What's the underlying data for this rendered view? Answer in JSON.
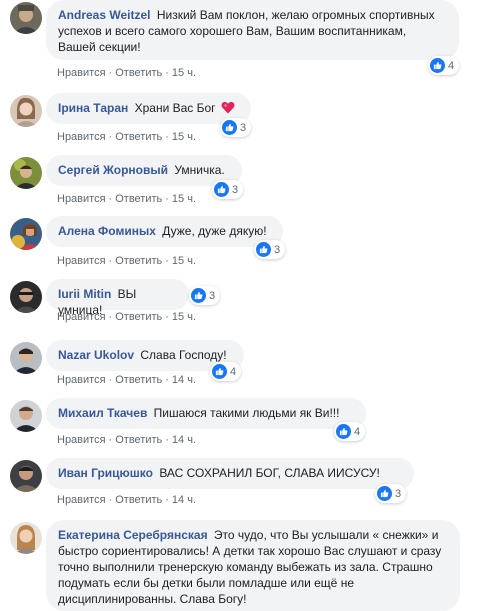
{
  "comments": [
    {
      "author": "Andreas Weitzel",
      "text": "Низкий Вам поклон, желаю огромных спортивных успехов и всего самого хорошего Вам, Вашим воспитанникам, Вашей секции!",
      "like_label": "Нравится",
      "reply_label": "Ответить",
      "time": "15 ч.",
      "reaction_count": "4"
    },
    {
      "author": "Ірина Таран",
      "text": "Храни Вас Бог",
      "like_label": "Нравится",
      "reply_label": "Ответить",
      "time": "15 ч.",
      "reaction_count": "3"
    },
    {
      "author": "Сергей Жорновый",
      "text": "Умничка.",
      "like_label": "Нравится",
      "reply_label": "Ответить",
      "time": "15 ч.",
      "reaction_count": "3"
    },
    {
      "author": "Алена Фоминых",
      "text": "Дуже, дуже дякую!",
      "like_label": "Нравится",
      "reply_label": "Ответить",
      "time": "15 ч.",
      "reaction_count": "3"
    },
    {
      "author": "Iurii Mitin",
      "text": "ВЫ умница!",
      "like_label": "Нравится",
      "reply_label": "Ответить",
      "time": "15 ч.",
      "reaction_count": "3"
    },
    {
      "author": "Nazar Ukolov",
      "text": "Слава Господу!",
      "like_label": "Нравится",
      "reply_label": "Ответить",
      "time": "14 ч.",
      "reaction_count": "4"
    },
    {
      "author": "Михаил Ткачев",
      "text": "Пишаюся такими людьми як Ви!!!",
      "like_label": "Нравится",
      "reply_label": "Ответить",
      "time": "14 ч.",
      "reaction_count": "4"
    },
    {
      "author": "Иван Грицюшко",
      "text": "ВАС СОХРАНИЛ БОГ, СЛАВА ИИСУСУ!",
      "like_label": "Нравится",
      "reply_label": "Ответить",
      "time": "14 ч.",
      "reaction_count": "3"
    },
    {
      "author": "Екатерина Серебрянская",
      "text": "Это чудо, что Вы услышали « снежки» и быстро сориентировались! А детки так хорошо Вас слушают и сразу точно выполнили тренерскую команду выбежать из зала. Страшно подумать если бы детки были помладше или ещё не дисциплинированны. Слава Богу!"
    }
  ],
  "colors": {
    "author_link": "#385898",
    "bubble_bg": "#f2f3f5",
    "meta_text": "#606770",
    "like_blue": "#1877f2"
  }
}
